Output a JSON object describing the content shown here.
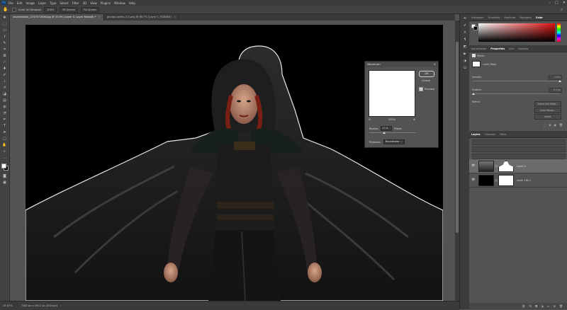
{
  "menubar": {
    "logo": "Ps",
    "items": [
      "File",
      "Edit",
      "Image",
      "Layer",
      "Type",
      "Select",
      "Filter",
      "3D",
      "View",
      "Plugins",
      "Window",
      "Help"
    ]
  },
  "options": {
    "items": [
      "Scroll All Windows",
      "100%",
      "Fit Screen",
      "Fill Screen"
    ]
  },
  "tabs": [
    {
      "label": "shutterstock_1747471506.jpg @ 25.6% (Layer 0, Layer Mask/8) *",
      "active": true
    },
    {
      "label": "grunge-series-2-5.png @ 66.7% (Layer 1, RGB/8#)",
      "active": false
    }
  ],
  "dialog": {
    "title": "Maximum",
    "ok": "OK",
    "cancel": "Cancel",
    "preview_label": "Preview",
    "preview_checked": true,
    "zoom": "100%",
    "radius_label": "Radius:",
    "radius_value": "17.4",
    "radius_unit": "Pixels",
    "radius_fraction": 0.3,
    "preserve_label": "Preserve:",
    "preserve_value": "Roundness"
  },
  "status": {
    "zoom": "25.67%",
    "doc": "7360 px x 4912 px (300 ppi)"
  },
  "colors": {
    "accent": "#31a8ff"
  },
  "panels": {
    "color_tabs": [
      "Histogram",
      "Gradients",
      "Swatches",
      "Navigator",
      "Color"
    ],
    "props_tabs": [
      "Adjustments",
      "Properties",
      "Info",
      "Libraries"
    ],
    "masks_title": "Masks",
    "layer_mask_label": "Layer Mask",
    "density_label": "Density:",
    "density_value": "100%",
    "feather_label": "Feather:",
    "feather_value": "0.0 px",
    "refine_label": "Refine:",
    "select_mask_label": "Select and Mask...",
    "color_range_label": "Color Range...",
    "invert_label": "Invert",
    "layers_tabs": [
      "Layers",
      "Channels",
      "Paths"
    ],
    "layers": [
      {
        "name": "Layer 0",
        "selected": true
      },
      {
        "name": "Layer 100 c",
        "selected": false
      }
    ]
  }
}
